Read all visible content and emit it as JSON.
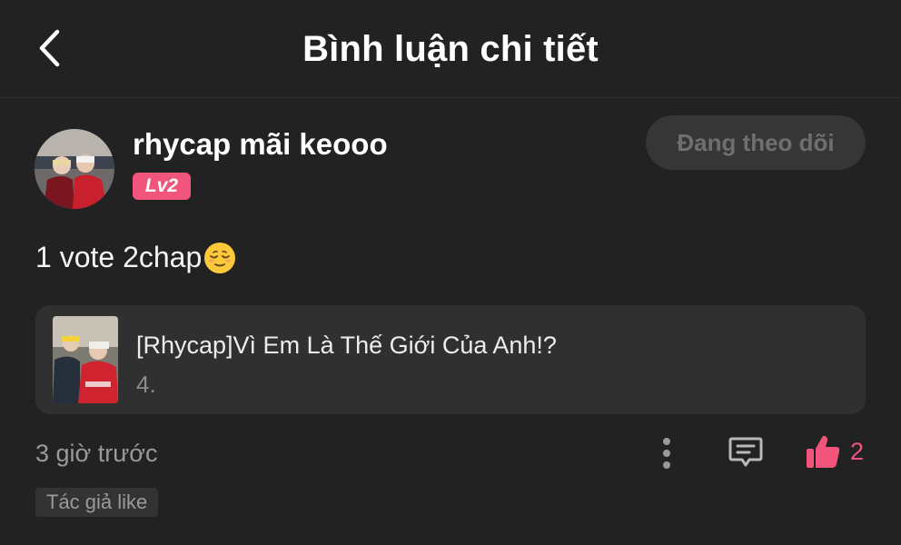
{
  "header": {
    "title": "Bình luận chi tiết",
    "back_icon": "chevron-left-icon"
  },
  "comment": {
    "username": "rhycap mãi keooo",
    "level": "Lv2",
    "follow_label": "Đang theo dõi",
    "text": "1 vote 2chap",
    "emoji_icon": "relieved-face-emoji",
    "manga": {
      "title": "[Rhycap]Vì Em Là Thế Giới Của Anh!?",
      "chapter": "4."
    },
    "time": "3 giờ trước",
    "like_count": "2",
    "author_like_label": "Tác giả like"
  },
  "colors": {
    "accent": "#f1557b",
    "background": "#222222",
    "card": "#303030"
  }
}
